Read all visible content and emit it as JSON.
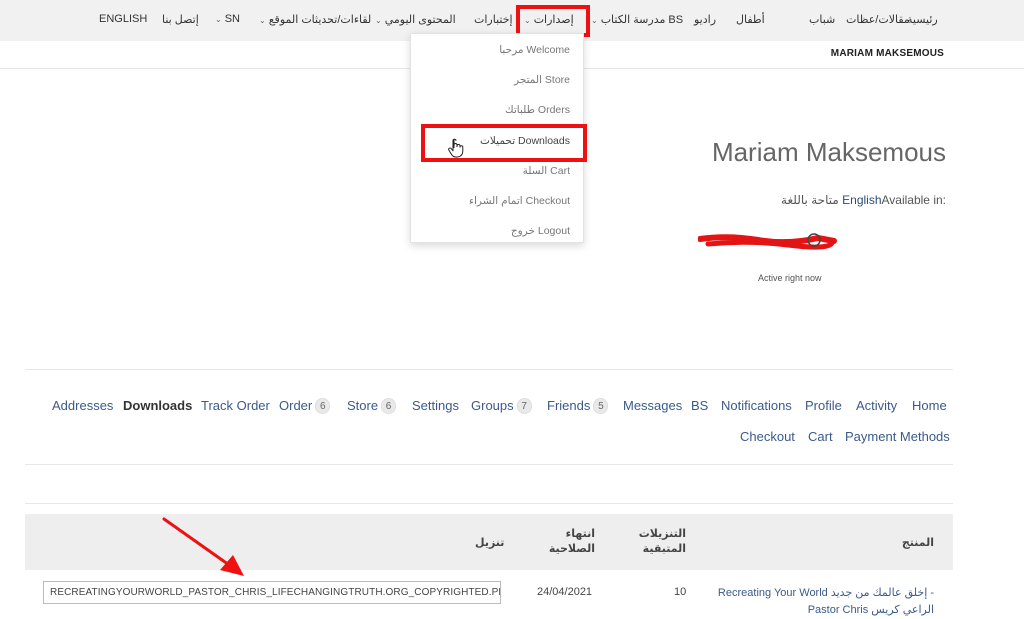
{
  "nav": {
    "items": [
      {
        "id": "home",
        "label": "رئيسية"
      },
      {
        "id": "articles",
        "label": "مقالات/عظات"
      },
      {
        "id": "youth",
        "label": "شباب"
      },
      {
        "id": "kids",
        "label": "أطفال"
      },
      {
        "id": "radio",
        "label": "راديو"
      },
      {
        "id": "bs_school",
        "label": "مدرسة الكتاب BS"
      },
      {
        "id": "releases",
        "label": "إصدارات"
      },
      {
        "id": "tests",
        "label": "إختبارات"
      },
      {
        "id": "daily",
        "label": "المحتوى اليومي"
      },
      {
        "id": "updates",
        "label": "لقاءات/تحديثات الموقع"
      },
      {
        "id": "sn",
        "label": "SN"
      },
      {
        "id": "contact",
        "label": "إتصل بنا"
      },
      {
        "id": "english",
        "label": "ENGLISH"
      }
    ]
  },
  "user_strip": {
    "name": "MARIAM MAKSEMOUS"
  },
  "dropdown": {
    "items": [
      {
        "label": "مرحبا Welcome"
      },
      {
        "label": "المتجر Store"
      },
      {
        "label": "طلباتك Orders"
      },
      {
        "label": "تحميلات Downloads"
      },
      {
        "label": "السلة Cart"
      },
      {
        "label": "اتمام الشراء Checkout"
      },
      {
        "label": "خروج Logout"
      }
    ]
  },
  "profile": {
    "display_name": "Mariam Maksemous",
    "available_prefix": "Available in: ",
    "available_lang": "English",
    "available_suffix": " متاحة باللغة",
    "status": "Active right now"
  },
  "tabs": [
    {
      "label": "Home"
    },
    {
      "label": "Activity"
    },
    {
      "label": "Profile"
    },
    {
      "label": "Notifications"
    },
    {
      "label": "BS"
    },
    {
      "label": "Messages"
    },
    {
      "label": "Friends",
      "count": "5"
    },
    {
      "label": "Groups",
      "count": "7"
    },
    {
      "label": "Settings"
    },
    {
      "label": "Store",
      "count": "6"
    },
    {
      "label": "Order",
      "count": "6"
    },
    {
      "label": "Track Order"
    },
    {
      "label": "Downloads"
    },
    {
      "label": "Addresses"
    },
    {
      "label": "Payment Methods"
    },
    {
      "label": "Cart"
    },
    {
      "label": "Checkout"
    }
  ],
  "table": {
    "headers": {
      "product": "المنتج",
      "remaining": "التنزيلات المتبقية",
      "expires": "انتهاء الصلاحية",
      "download": "تنزيل"
    },
    "rows": [
      {
        "product": "Recreating Your World إخلق عالمك من جديد - Pastor Chris الراعي كريس",
        "remaining": "10",
        "expires": "24/04/2021",
        "file": "RECREATINGYOURWORLD_PASTOR_CHRIS_LIFECHANGINGTRUTH.ORG_COPYRIGHTED.PDF"
      }
    ]
  },
  "colors": {
    "highlight": "#ee1111",
    "link": "#3b5a8a",
    "nav_bg": "#f1f1f1"
  }
}
